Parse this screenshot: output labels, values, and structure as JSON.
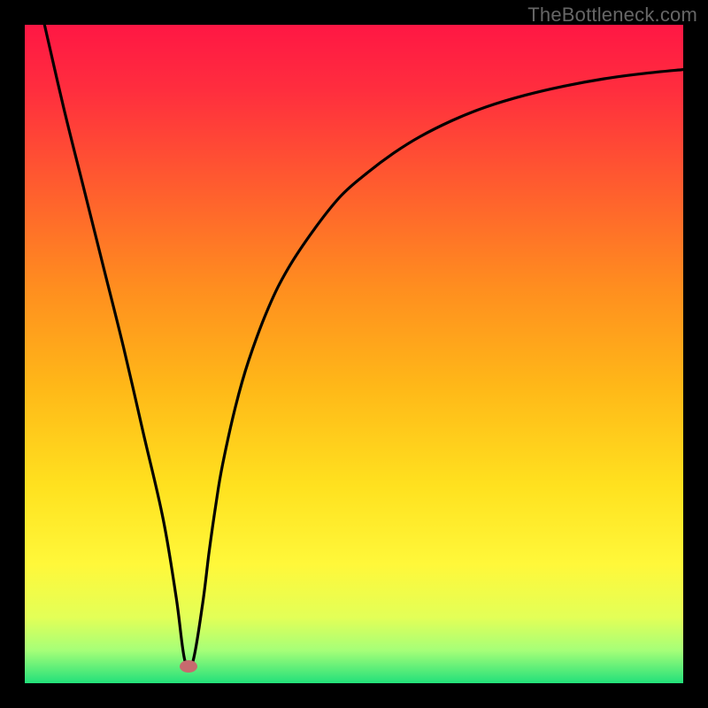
{
  "watermark": "TheBottleneck.com",
  "chart_data": {
    "type": "line",
    "title": "",
    "xlabel": "",
    "ylabel": "",
    "xlim": [
      0,
      100
    ],
    "ylim": [
      0,
      100
    ],
    "background_gradient": {
      "stops": [
        {
          "pos": 0.0,
          "color": "#ff1744"
        },
        {
          "pos": 0.1,
          "color": "#ff2e3e"
        },
        {
          "pos": 0.25,
          "color": "#ff5e2e"
        },
        {
          "pos": 0.4,
          "color": "#ff8e1f"
        },
        {
          "pos": 0.55,
          "color": "#ffb818"
        },
        {
          "pos": 0.7,
          "color": "#ffe11f"
        },
        {
          "pos": 0.82,
          "color": "#fff83a"
        },
        {
          "pos": 0.9,
          "color": "#e3ff57"
        },
        {
          "pos": 0.95,
          "color": "#a6ff78"
        },
        {
          "pos": 1.0,
          "color": "#22e07a"
        }
      ]
    },
    "series": [
      {
        "name": "bottleneck-curve",
        "color": "#000000",
        "x": [
          3.0,
          6,
          9,
          12,
          15,
          18,
          21,
          23,
          24.3,
          25.5,
          27,
          28,
          29,
          30,
          32,
          34,
          37,
          40,
          44,
          48,
          52,
          56,
          60,
          65,
          70,
          76,
          82,
          88,
          94,
          100
        ],
        "y": [
          100,
          87,
          75,
          63,
          51,
          38,
          25,
          13,
          3.5,
          3.2,
          12,
          20,
          27,
          33,
          42,
          49,
          57,
          63,
          69,
          74,
          77.5,
          80.5,
          83,
          85.5,
          87.5,
          89.3,
          90.7,
          91.8,
          92.6,
          93.2
        ]
      }
    ],
    "marker": {
      "x": 24.8,
      "y": 2.6,
      "color": "#c76a6e"
    },
    "grid": false,
    "legend": false
  }
}
